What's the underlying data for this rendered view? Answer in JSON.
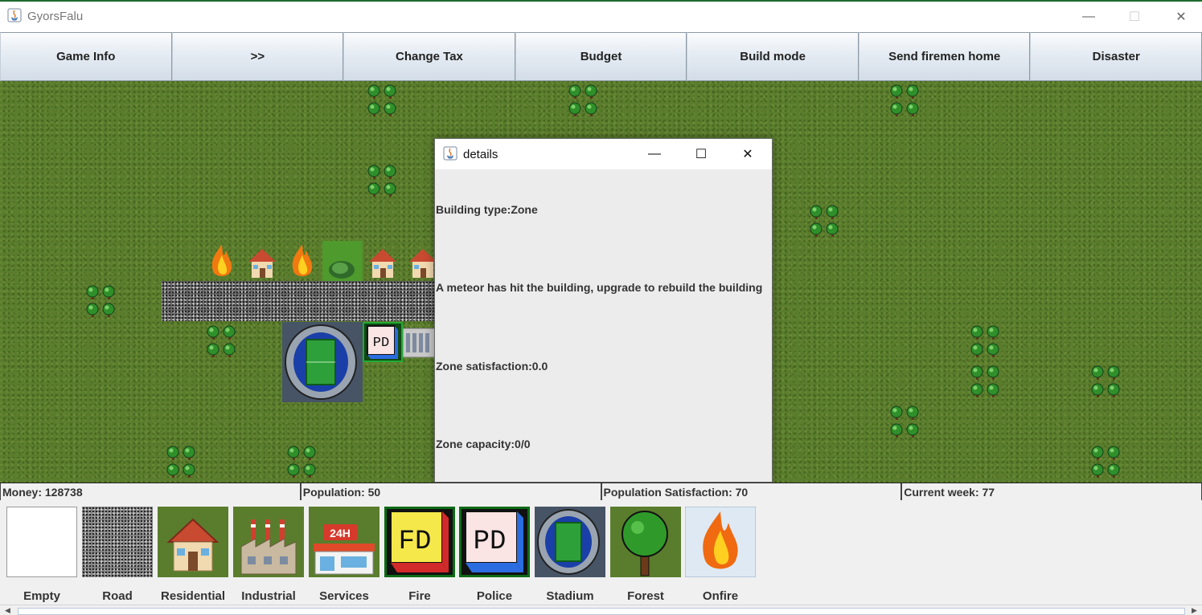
{
  "window": {
    "title": "GyorsFalu",
    "minimize": "—",
    "maximize": "☐",
    "close": "✕"
  },
  "toolbar": {
    "buttons": [
      "Game Info",
      ">>",
      "Change Tax",
      "Budget",
      "Build mode",
      "Send firemen home",
      "Disaster"
    ]
  },
  "dialog": {
    "title": "details",
    "lines": [
      "Building type:Zone",
      "A meteor has hit the building, upgrade to rebuild the building",
      "Zone satisfaction:0.0",
      "Zone capacity:0/0"
    ]
  },
  "status": {
    "money": "Money: 128738",
    "population": "Population: 50",
    "satisfaction": "Population Satisfaction: 70",
    "week": "Current week: 77"
  },
  "palette": {
    "items": [
      "Empty",
      "Road",
      "Residential",
      "Industrial",
      "Services",
      "Fire",
      "Police",
      "Stadium",
      "Forest",
      "Onfire"
    ],
    "services_sign": "24H",
    "fire_sign": "FD",
    "police_sign": "PD"
  },
  "map": {
    "pd_sign": "PD"
  },
  "colors": {
    "grass": "#5a7d2d",
    "fire_frame": "#0d6b16",
    "police_blue": "#2b6de0",
    "fire_yellow": "#f5e84a"
  }
}
